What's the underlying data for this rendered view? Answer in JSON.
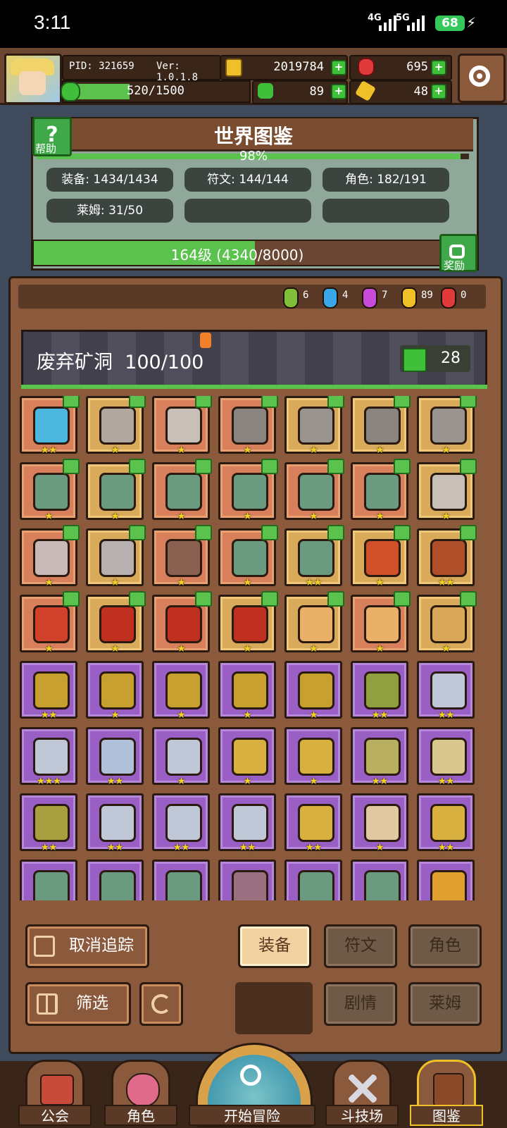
{
  "status_bar": {
    "time": "3:11",
    "network1": "4G",
    "network2": "5G",
    "battery": "68"
  },
  "header": {
    "pid": "PID: 321659",
    "version": "Ver: 1.0.1.8",
    "gold": "2019784",
    "ruby": "695",
    "clover": "89",
    "ore": "48",
    "exp": "520/1500",
    "exp_fraction": 0.347
  },
  "world": {
    "title": "世界图鉴",
    "percent": "98%",
    "percent_value": 0.98,
    "help_label": "帮助",
    "stats": {
      "equipment": "装备: 1434/1434",
      "runes": "符文: 144/144",
      "characters": "角色: 182/191",
      "slime": "莱姆: 31/50"
    },
    "level_text": "164级 (4340/8000)",
    "level_fraction": 0.5425,
    "reward_label": "奖励"
  },
  "gems": [
    {
      "color": "#7fbf3a",
      "value": "6"
    },
    {
      "color": "#3aa8e8",
      "value": "4"
    },
    {
      "color": "#c84ad8",
      "value": "7"
    },
    {
      "color": "#f0c028",
      "value": "89"
    },
    {
      "color": "#e03a3a",
      "value": "0"
    }
  ],
  "area": {
    "name": "废弃矿洞",
    "progress": "100/100",
    "likes": "28"
  },
  "items": [
    {
      "bg": "o",
      "color": "#4cb8e0",
      "stars": "★★",
      "thumb": true
    },
    {
      "bg": "y",
      "color": "#b0a8a0",
      "stars": "★",
      "thumb": true
    },
    {
      "bg": "o",
      "color": "#c8c0b8",
      "stars": "★",
      "thumb": true
    },
    {
      "bg": "o",
      "color": "#8a8480",
      "stars": "★",
      "thumb": true
    },
    {
      "bg": "y",
      "color": "#9a9490",
      "stars": "★",
      "thumb": true
    },
    {
      "bg": "y",
      "color": "#8a8480",
      "stars": "★",
      "thumb": true
    },
    {
      "bg": "y",
      "color": "#9a9490",
      "stars": "★",
      "thumb": true
    },
    {
      "bg": "o",
      "color": "#6a9a80",
      "stars": "★",
      "thumb": true
    },
    {
      "bg": "y",
      "color": "#6a9a80",
      "stars": "★",
      "thumb": true
    },
    {
      "bg": "o",
      "color": "#6a9a80",
      "stars": "★",
      "thumb": true
    },
    {
      "bg": "o",
      "color": "#6a9a80",
      "stars": "★",
      "thumb": true
    },
    {
      "bg": "o",
      "color": "#6a9a80",
      "stars": "★",
      "thumb": true
    },
    {
      "bg": "o",
      "color": "#6a9a80",
      "stars": "★",
      "thumb": true
    },
    {
      "bg": "y",
      "color": "#c8c0b8",
      "stars": "★",
      "thumb": true
    },
    {
      "bg": "o",
      "color": "#c8b8b8",
      "stars": "★",
      "thumb": true
    },
    {
      "bg": "y",
      "color": "#b8b0b0",
      "stars": "★",
      "thumb": true
    },
    {
      "bg": "o",
      "color": "#8a6050",
      "stars": "★",
      "thumb": true
    },
    {
      "bg": "o",
      "color": "#6a9a80",
      "stars": "★",
      "thumb": true
    },
    {
      "bg": "y",
      "color": "#6a9a80",
      "stars": "★★",
      "thumb": true
    },
    {
      "bg": "y",
      "color": "#d0502a",
      "stars": "★",
      "thumb": true
    },
    {
      "bg": "y",
      "color": "#b0502a",
      "stars": "★★",
      "thumb": true
    },
    {
      "bg": "o",
      "color": "#d0402a",
      "stars": "★",
      "thumb": true
    },
    {
      "bg": "y",
      "color": "#c03020",
      "stars": "★",
      "thumb": true
    },
    {
      "bg": "o",
      "color": "#c03020",
      "stars": "★",
      "thumb": true
    },
    {
      "bg": "y",
      "color": "#c03020",
      "stars": "★",
      "thumb": true
    },
    {
      "bg": "y",
      "color": "#e8b068",
      "stars": "★",
      "thumb": true
    },
    {
      "bg": "o",
      "color": "#e8b068",
      "stars": "★",
      "thumb": true
    },
    {
      "bg": "y",
      "color": "#d8a858",
      "stars": "★",
      "thumb": true
    },
    {
      "bg": "p",
      "color": "#c8a030",
      "stars": "★★",
      "thumb": false
    },
    {
      "bg": "p",
      "color": "#c8a030",
      "stars": "★",
      "thumb": false
    },
    {
      "bg": "p",
      "color": "#c8a030",
      "stars": "★",
      "thumb": false
    },
    {
      "bg": "p",
      "color": "#c8a030",
      "stars": "★",
      "thumb": false
    },
    {
      "bg": "p",
      "color": "#c8a030",
      "stars": "★",
      "thumb": false
    },
    {
      "bg": "p",
      "color": "#90a040",
      "stars": "★★",
      "thumb": false
    },
    {
      "bg": "p",
      "color": "#c0c8d8",
      "stars": "★★",
      "thumb": false
    },
    {
      "bg": "p",
      "color": "#c0c8d8",
      "stars": "★★★",
      "thumb": false
    },
    {
      "bg": "p",
      "color": "#b0c0d8",
      "stars": "★★",
      "thumb": false
    },
    {
      "bg": "p",
      "color": "#c0c8d8",
      "stars": "★",
      "thumb": false
    },
    {
      "bg": "p",
      "color": "#d8b040",
      "stars": "★",
      "thumb": false
    },
    {
      "bg": "p",
      "color": "#d8b040",
      "stars": "★",
      "thumb": false
    },
    {
      "bg": "p",
      "color": "#b8b060",
      "stars": "★★",
      "thumb": false
    },
    {
      "bg": "p",
      "color": "#d8c890",
      "stars": "★★",
      "thumb": false
    },
    {
      "bg": "p",
      "color": "#a8a040",
      "stars": "★★",
      "thumb": false
    },
    {
      "bg": "p",
      "color": "#c0c8d8",
      "stars": "★★",
      "thumb": false
    },
    {
      "bg": "p",
      "color": "#c0c8d8",
      "stars": "★★",
      "thumb": false
    },
    {
      "bg": "p",
      "color": "#c0c8d8",
      "stars": "★★",
      "thumb": false
    },
    {
      "bg": "p",
      "color": "#d8b040",
      "stars": "★★",
      "thumb": false
    },
    {
      "bg": "p",
      "color": "#e0c8a0",
      "stars": "★",
      "thumb": false
    },
    {
      "bg": "p",
      "color": "#d8b040",
      "stars": "★★",
      "thumb": false
    },
    {
      "bg": "p",
      "color": "#6a9a80",
      "stars": "",
      "thumb": false
    },
    {
      "bg": "p",
      "color": "#6a9a80",
      "stars": "",
      "thumb": false
    },
    {
      "bg": "p",
      "color": "#6a9a80",
      "stars": "",
      "thumb": false
    },
    {
      "bg": "p",
      "color": "#9a7080",
      "stars": "",
      "thumb": false
    },
    {
      "bg": "p",
      "color": "#6a9a80",
      "stars": "",
      "thumb": false
    },
    {
      "bg": "p",
      "color": "#6a9a80",
      "stars": "",
      "thumb": false
    },
    {
      "bg": "p",
      "color": "#e0a030",
      "stars": "",
      "thumb": false
    }
  ],
  "controls": {
    "untrack": "取消追踪",
    "filter": "筛选",
    "tab_equipment": "装备",
    "tab_runes": "符文",
    "tab_characters": "角色",
    "tab_story": "剧情",
    "tab_slime": "莱姆"
  },
  "nav": {
    "guild": "公会",
    "character": "角色",
    "adventure": "开始冒险",
    "arena": "斗技场",
    "codex": "图鉴"
  }
}
